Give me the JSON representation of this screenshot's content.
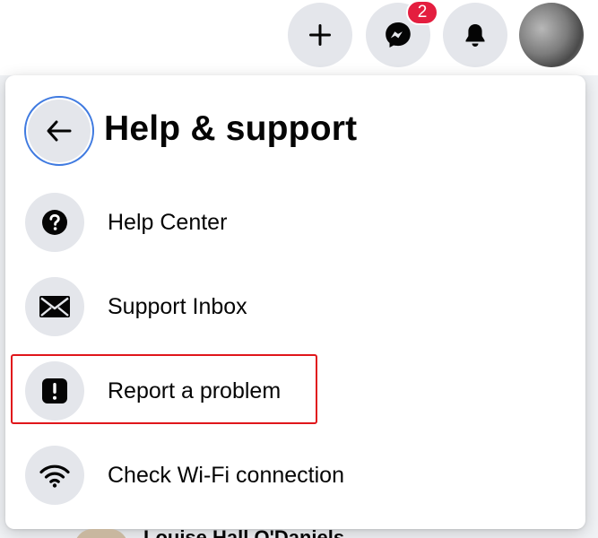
{
  "topbar": {
    "notification_badge": "2"
  },
  "panel": {
    "title": "Help & support",
    "items": [
      {
        "label": "Help Center",
        "icon": "question-icon"
      },
      {
        "label": "Support Inbox",
        "icon": "envelope-icon"
      },
      {
        "label": "Report a problem",
        "icon": "exclamation-icon"
      },
      {
        "label": "Check Wi-Fi connection",
        "icon": "wifi-icon"
      }
    ]
  },
  "feed": {
    "peek_text": "Louise Hall O'Daniels"
  },
  "colors": {
    "badge": "#e41e3f",
    "highlight": "#e0161b",
    "focus_ring": "#3f7ae0",
    "icon_bg": "#e4e6eb"
  }
}
